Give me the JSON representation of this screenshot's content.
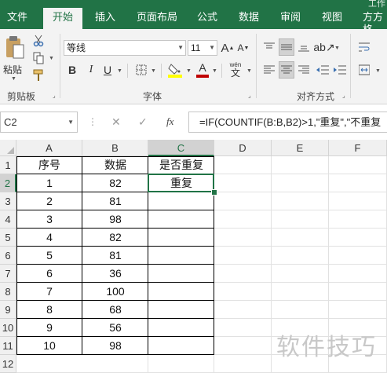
{
  "ribbon": {
    "tabs": [
      "文件",
      "开始",
      "插入",
      "页面布局",
      "公式",
      "数据",
      "审阅",
      "视图",
      "方方格"
    ],
    "title_fragment": "工作",
    "clipboard": {
      "paste_label": "粘贴",
      "group_label": "剪贴板"
    },
    "font": {
      "name": "等线",
      "size": "11",
      "group_label": "字体",
      "bold": "B",
      "italic": "I",
      "underline": "U",
      "grow": "A",
      "shrink": "A",
      "font_color_glyph": "A",
      "phonetic": "wén",
      "phonetic_char": "文"
    },
    "alignment": {
      "group_label": "对齐方式"
    }
  },
  "formula_bar": {
    "name_box": "C2",
    "cancel_glyph": "✕",
    "enter_glyph": "✓",
    "fx_glyph": "fx",
    "formula": "=IF(COUNTIF(B:B,B2)>1,\"重复\",\"不重复"
  },
  "sheet": {
    "columns": [
      "A",
      "B",
      "C",
      "D",
      "E",
      "F"
    ],
    "rows": [
      "1",
      "2",
      "3",
      "4",
      "5",
      "6",
      "7",
      "8",
      "9",
      "10",
      "11",
      "12"
    ],
    "selected_cell": "C2",
    "header": [
      "序号",
      "数据",
      "是否重复"
    ],
    "data": [
      [
        "1",
        "82",
        "重复"
      ],
      [
        "2",
        "81",
        ""
      ],
      [
        "3",
        "98",
        ""
      ],
      [
        "4",
        "82",
        ""
      ],
      [
        "5",
        "81",
        ""
      ],
      [
        "6",
        "36",
        ""
      ],
      [
        "7",
        "100",
        ""
      ],
      [
        "8",
        "68",
        ""
      ],
      [
        "9",
        "56",
        ""
      ],
      [
        "10",
        "98",
        ""
      ]
    ]
  },
  "watermark": "软件技巧",
  "colors": {
    "accent": "#217346",
    "font_color_bar": "#c00000",
    "highlight_bar": "#ffff00"
  }
}
